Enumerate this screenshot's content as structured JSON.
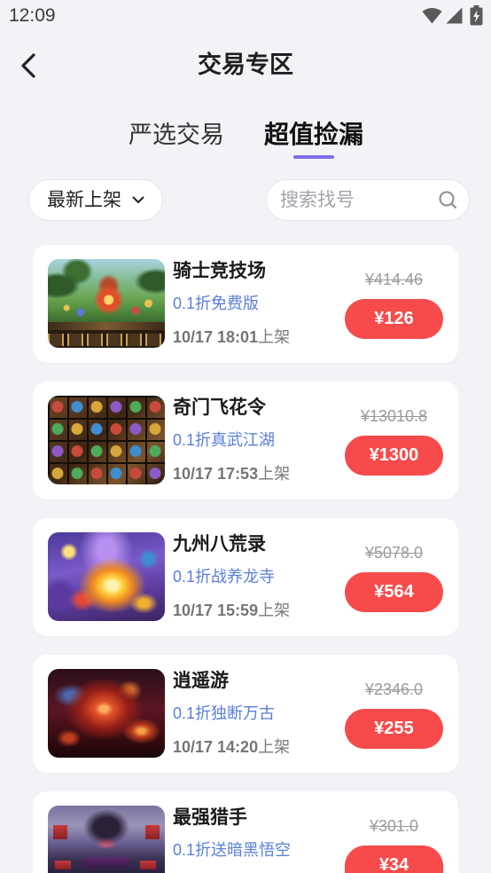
{
  "status_bar": {
    "time": "12:09",
    "icons": [
      "wifi-icon",
      "signal-icon",
      "battery-charging-icon"
    ]
  },
  "header": {
    "title": "交易专区",
    "back_icon": "chevron-left-icon"
  },
  "tabs": [
    {
      "label": "严选交易",
      "active": false
    },
    {
      "label": "超值捡漏",
      "active": true
    }
  ],
  "filters": {
    "sort": {
      "selected": "最新上架",
      "icon": "chevron-down-icon"
    },
    "search": {
      "placeholder": "搜索找号",
      "icon": "search-icon"
    }
  },
  "labels": {
    "listed_suffix": "上架"
  },
  "listings": [
    {
      "game": "骑士竞技场",
      "offer": "0.1折免费版",
      "listed_time": "10/17 18:01",
      "original_price": "¥414.46",
      "price": "¥126"
    },
    {
      "game": "奇门飞花令",
      "offer": "0.1折真武江湖",
      "listed_time": "10/17 17:53",
      "original_price": "¥13010.8",
      "price": "¥1300"
    },
    {
      "game": "九州八荒录",
      "offer": "0.1折战养龙寺",
      "listed_time": "10/17 15:59",
      "original_price": "¥5078.0",
      "price": "¥564"
    },
    {
      "game": "逍遥游",
      "offer": "0.1折独断万古",
      "listed_time": "10/17 14:20",
      "original_price": "¥2346.0",
      "price": "¥255"
    },
    {
      "game": "最强猎手",
      "offer": "0.1折送暗黑悟空",
      "original_price": "¥301.0",
      "price": "¥34"
    }
  ],
  "colors": {
    "background": "#f3f2f7",
    "card": "#ffffff",
    "tab_indicator": "#7b6fea",
    "offer_text": "#5a7fd8",
    "price_button": "#f74b4b",
    "original_price": "#9b9b9b"
  }
}
